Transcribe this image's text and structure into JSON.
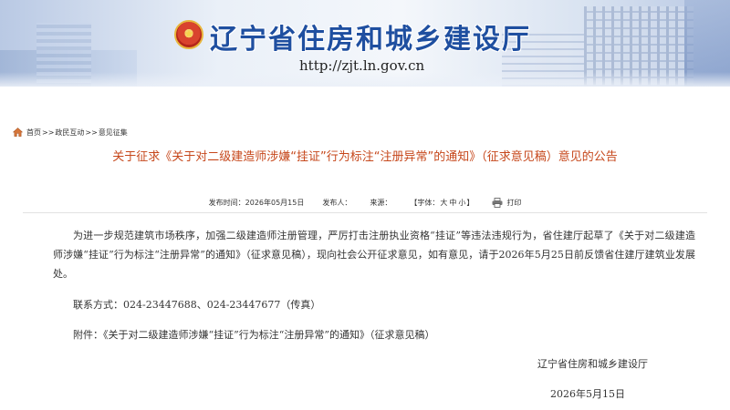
{
  "header": {
    "site_title": "辽宁省住房和城乡建设厅",
    "site_url": "http://zjt.ln.gov.cn"
  },
  "breadcrumb": {
    "items": [
      "首页",
      "政民互动",
      "意见征集"
    ],
    "separator": ">>"
  },
  "article": {
    "title": "关于征求《关于对二级建造师涉嫌“挂证”行为标注“注册异常”的通知》（征求意见稿）意见的公告",
    "meta": {
      "publish_label": "发布时间：",
      "publish_date": "2026年05月15日",
      "publisher_label": "发布人：",
      "source_label": "来源：",
      "font_label": "【字体：",
      "font_large": "大",
      "font_medium": "中",
      "font_small": "小",
      "font_close": "】",
      "print_label": "打印"
    },
    "paragraph": "为进一步规范建筑市场秩序，加强二级建造师注册管理，严厉打击注册执业资格“挂证”等违法违规行为，省住建厅起草了《关于对二级建造师涉嫌“挂证”行为标注“注册异常”的通知》（征求意见稿），现向社会公开征求意见，如有意见，请于2026年5月25日前反馈省住建厅建筑业发展处。",
    "contact": "联系方式：024-23447688、024-23447677（传真）",
    "attachment_label": "附件：",
    "attachment_link": "《关于对二级建造师涉嫌“挂证”行为标注“注册异常”的通知》（征求意见稿）",
    "signature_org": "辽宁省住房和城乡建设厅",
    "signature_date": "2026年5月15日"
  },
  "colors": {
    "title_color": "#c6471b",
    "banner_title_color": "#1f4fa0"
  },
  "icons": [
    "emblem-icon",
    "home-icon",
    "printer-icon"
  ]
}
